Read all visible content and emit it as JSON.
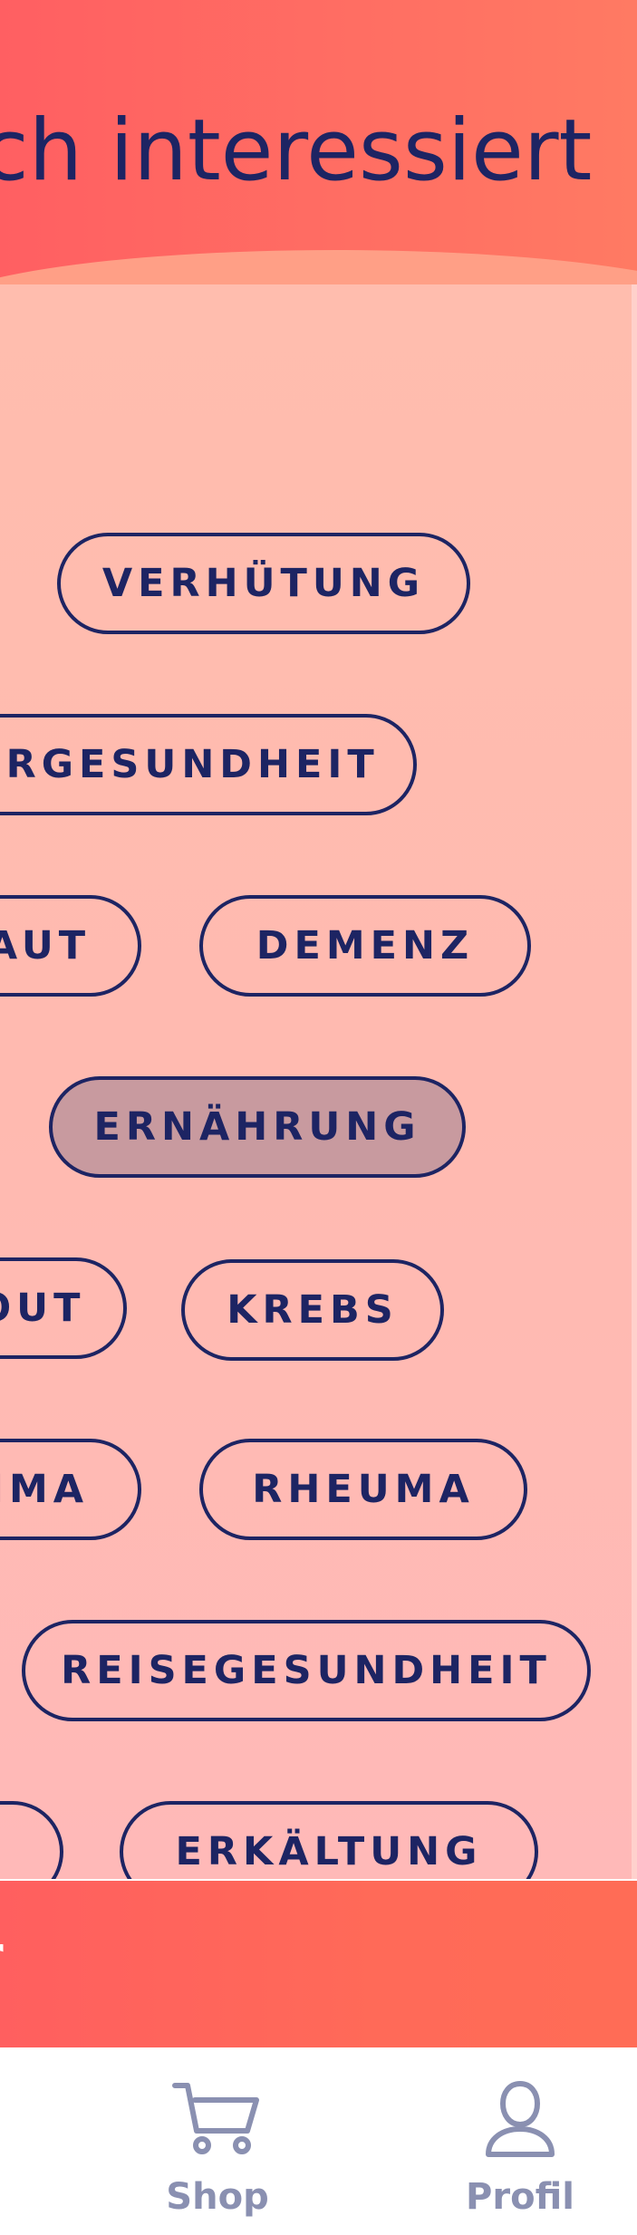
{
  "header": {
    "title": "ch interessiert"
  },
  "topics": [
    {
      "label": "VERHÜTUNG",
      "selected": false
    },
    {
      "label": "ERGESUNDHEIT",
      "selected": false
    },
    {
      "label": "AUT",
      "selected": false
    },
    {
      "label": "DEMENZ",
      "selected": false
    },
    {
      "label": "ERNÄHRUNG",
      "selected": true
    },
    {
      "label": "OUT",
      "selected": false
    },
    {
      "label": "KREBS",
      "selected": false
    },
    {
      "label": "IMA",
      "selected": false
    },
    {
      "label": "RHEUMA",
      "selected": false
    },
    {
      "label": "REISEGESUNDHEIT",
      "selected": false
    },
    {
      "label": "",
      "selected": false
    },
    {
      "label": "ERKÄLTUNG",
      "selected": false
    }
  ],
  "cta": {
    "label": "r"
  },
  "bottom_nav": {
    "items": [
      {
        "label": "Shop",
        "icon": "shopping-cart-icon"
      },
      {
        "label": "Profil",
        "icon": "user-profile-icon"
      }
    ]
  },
  "colors": {
    "header_bg": "#ff6a62",
    "content_bg": "#ffbcb1",
    "chip_border": "#1d2463",
    "chip_text": "#1d2463",
    "chip_selected_bg": "#c89a9f",
    "cta_bg": "#ff6258",
    "nav_label": "#8a90b1"
  }
}
